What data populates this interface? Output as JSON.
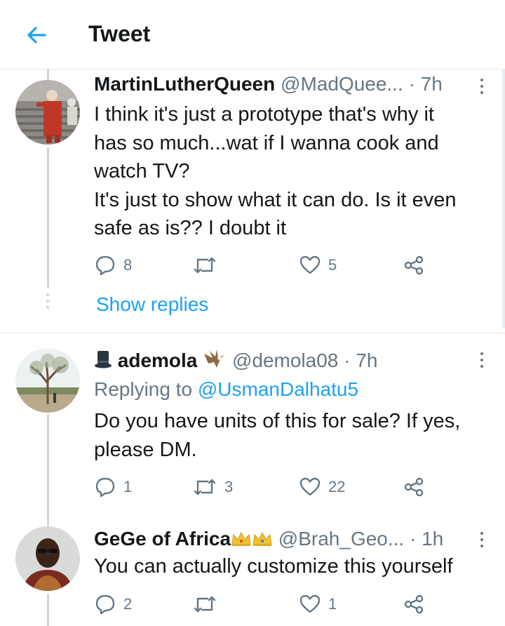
{
  "header": {
    "title": "Tweet",
    "back_icon": "arrow-left-icon",
    "accent": "#1da1f2"
  },
  "show_replies_label": "Show replies",
  "tweets": [
    {
      "name": "MartinLutherQueen",
      "handle": "@MadQuee...",
      "time": "7h",
      "text_lines": [
        "I think it's just a prototype that's why it",
        "has so much...wat if I wanna cook and",
        "watch TV?",
        "It's just to show what it can do. Is it even",
        "safe as is?? I doubt it"
      ],
      "replies": "8",
      "retweets": "",
      "likes": "5"
    },
    {
      "name": "ademola",
      "handle": "@demola08",
      "time": "7h",
      "replying_label": "Replying to",
      "replying_to": "@UsmanDalhatu5",
      "text_lines": [
        "Do you have units of this for sale? If yes,",
        "please DM."
      ],
      "replies": "1",
      "retweets": "3",
      "likes": "22"
    },
    {
      "name": "GeGe of Africa",
      "handle": "@Brah_Geo...",
      "time": "1h",
      "text_lines": [
        "You can actually customize this yourself"
      ],
      "replies": "2",
      "retweets": "",
      "likes": "1"
    }
  ],
  "dot_separator": "·",
  "colors": {
    "text": "#14171a",
    "secondary": "#657786",
    "link": "#1da1f2",
    "line": "#ccd6dd"
  }
}
